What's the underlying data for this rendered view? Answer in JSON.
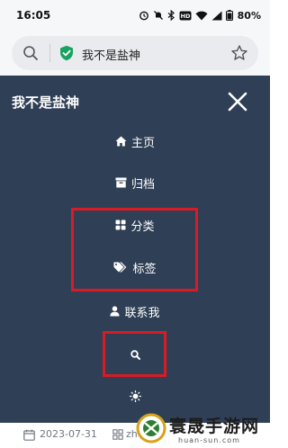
{
  "status_bar": {
    "time": "16:05",
    "battery": "80%",
    "icons": [
      "alarm-icon",
      "dnd-icon",
      "bluetooth-icon",
      "hd-icon",
      "wifi-icon",
      "signal-icon",
      "battery-icon"
    ]
  },
  "browser": {
    "url_text": "我不是盐神",
    "icons": [
      "search-icon",
      "shield-check-icon",
      "star-icon"
    ]
  },
  "nav": {
    "site_title": "我不是盐神",
    "close_icon": "close-icon",
    "items": [
      {
        "label": "主页",
        "icon": "home-icon"
      },
      {
        "label": "归档",
        "icon": "archive-icon"
      },
      {
        "label": "分类",
        "icon": "grid-icon"
      },
      {
        "label": "标签",
        "icon": "tag-icon"
      },
      {
        "label": "联系我",
        "icon": "user-icon"
      },
      {
        "label": "",
        "icon": "search-icon"
      },
      {
        "label": "",
        "icon": "sun-icon"
      }
    ]
  },
  "meta": {
    "date": "2023-07-31",
    "category": "zh"
  },
  "watermark": {
    "title": "寰晟手游网",
    "url": "huan-sun.com"
  },
  "colors": {
    "nav_background": "#2f3f55",
    "highlight_border": "#d81b24",
    "shield_green": "#1aa260",
    "url_bar": "#e9ebee"
  }
}
